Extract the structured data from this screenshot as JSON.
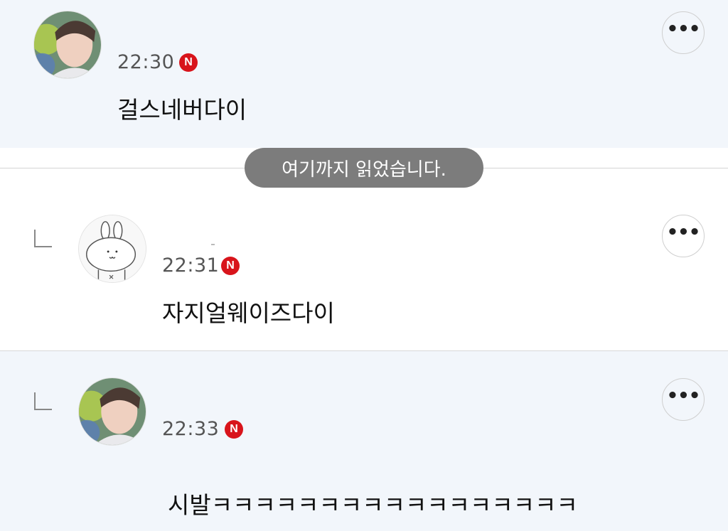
{
  "comments": [
    {
      "time": "22:30",
      "badge": "N",
      "text": "걸스네버다이",
      "is_reply": false,
      "avatar": "profile-photo-person"
    },
    {
      "time": "22:31",
      "badge": "N",
      "text": "자지얼웨이즈다이",
      "is_reply": true,
      "avatar": "rabbit-illustration"
    },
    {
      "time": "22:33",
      "badge": "N",
      "text": "시발ㅋㅋㅋㅋㅋㅋㅋㅋㅋㅋㅋㅋㅋㅋㅋㅋㅋ",
      "is_reply": true,
      "avatar": "profile-photo-person"
    }
  ],
  "read_marker": {
    "label": "여기까지 읽었습니다."
  },
  "icons": {
    "more": "more-options-icon",
    "reply": "reply-arrow-icon",
    "badge": "new-badge-icon"
  },
  "colors": {
    "badge": "#d8141b",
    "highlight_bg": "#f2f6fb",
    "pill_bg": "#7c7c7c"
  }
}
